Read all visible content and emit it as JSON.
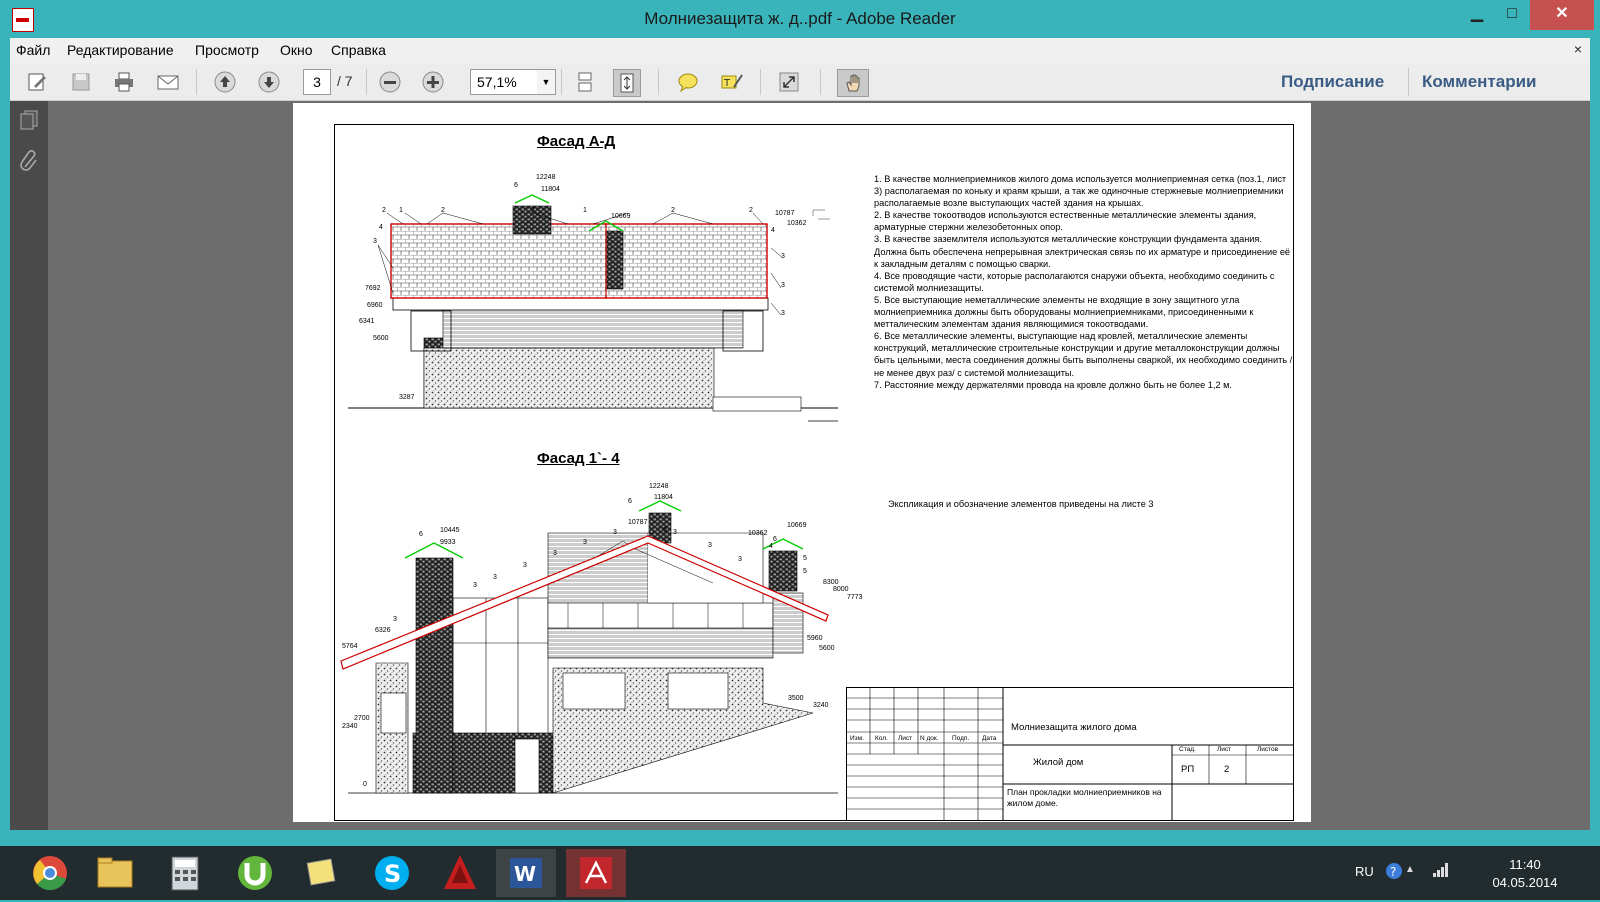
{
  "window": {
    "title": "Молниезащита ж. д..pdf - Adobe Reader",
    "minimize": "▁",
    "maximize": "□",
    "close": "✕"
  },
  "menu": {
    "items": [
      "Файл",
      "Редактирование",
      "Просмотр",
      "Окно",
      "Справка"
    ],
    "close": "×"
  },
  "toolbar": {
    "page_current": "3",
    "page_total": "/ 7",
    "zoom": "57,1%",
    "sign": "Подписание",
    "comments": "Комментарии"
  },
  "document": {
    "facade1_title": "Фасад А-Д",
    "facade2_title": "Фасад 1`- 4",
    "notes": [
      "1. В качестве молниеприемников жилого дома используется молниеприемная сетка (поз.1, лист 3) располагаемая по коньку и краям крыши, а так же одиночные стержневые молниеприемники располагаемые возле выступающих частей здания на крышах.",
      "2. В качестве токоотводов используются естественные металлические элементы здания, арматурные стержни железобетонных опор.",
      "3. В качестве заземлителя используются металлические конструкции фундамента здания. Должна быть обеспечена непрерывная электрическая связь по их арматуре и присоединение её к закладным деталям с помощью сварки.",
      "4. Все проводящие части, которые располагаются снаружи объекта, необходимо соединить с системой молниезащиты.",
      "5. Все выступающие неметаллические элементы не входящие в зону защитного угла молниеприемника должны быть оборудованы молниеприемниками, присоединенными к метталическим элементам здания являющимися токоотводами.",
      "6. Все металлические элементы, выступающие над кровлей, металлические элементы конструкций, металлические строительные конструкции и другие металлоконструкции должны быть цельными, места соединения должны быть выполнены сваркой, их необходимо соединить / не менее двух раз/ с системой молниезащиты.",
      "7. Расстояние между держателями провода на кровле должно быть не более 1,2 м."
    ],
    "explication": "Экспликация и обозначение элементов приведены на листе 3",
    "elevations_top": [
      "12248",
      "11804",
      "10669",
      "10787",
      "10362",
      "7692",
      "6960",
      "6341",
      "5600",
      "3287"
    ],
    "elevations_bottom": [
      "12248",
      "11804",
      "10787",
      "10445",
      "9933",
      "10362",
      "10669",
      "8300",
      "8000",
      "7773",
      "6326",
      "5764",
      "5960",
      "5600",
      "3500",
      "3240",
      "2700",
      "2340",
      "0"
    ],
    "stamp": {
      "cols": [
        "Изм.",
        "Кол.",
        "Лист",
        "N док.",
        "Подп.",
        "Дата"
      ],
      "project": "Молниезащита жилого дома",
      "building": "Жилой дом",
      "sheet_title": "План прокладки молниеприемников на жилом доме.",
      "stage_label": "Стад.",
      "sheet_label": "Лист",
      "sheets_label": "Листов",
      "stage": "РП",
      "sheet": "2"
    }
  },
  "taskbar": {
    "lang": "RU",
    "time": "11:40",
    "date": "04.05.2014"
  }
}
